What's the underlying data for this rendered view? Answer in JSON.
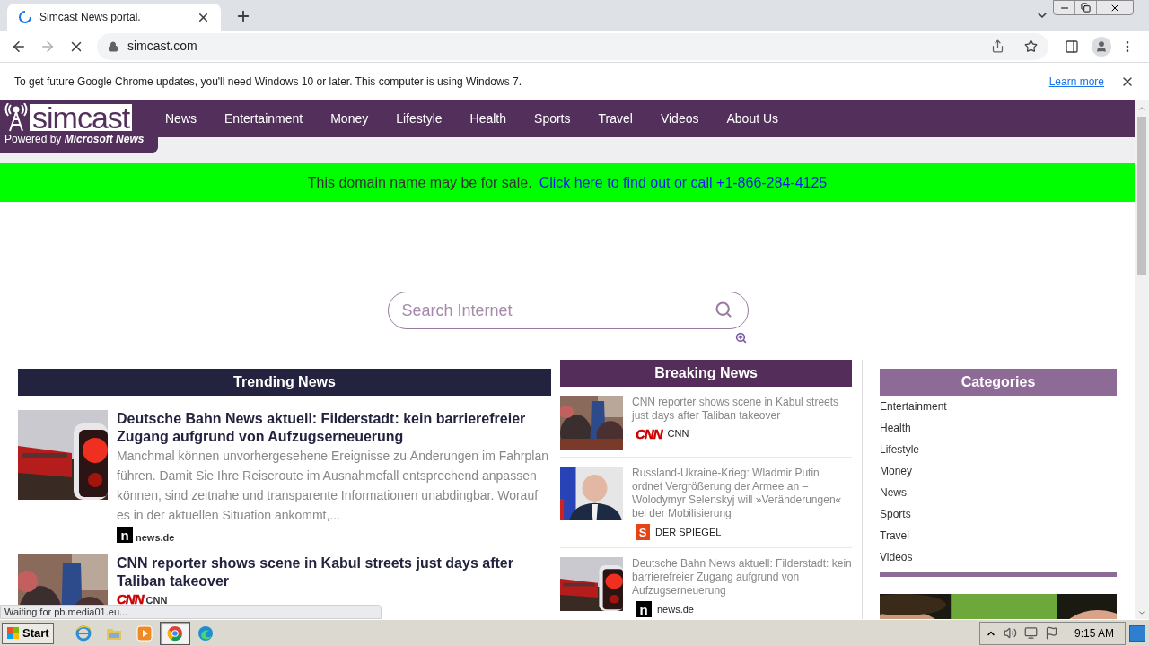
{
  "browser": {
    "tab": {
      "title": "Simcast News portal.",
      "loading": true
    },
    "address": "simcast.com",
    "infobar": {
      "message": "To get future Google Chrome updates, you'll need Windows 10 or later. This computer is using Windows 7.",
      "link": "Learn more"
    },
    "status": "Waiting for pb.media01.eu..."
  },
  "site": {
    "logo": {
      "name": "simcast",
      "tagline": "Powered by ",
      "tagline_bold": "Microsoft News"
    },
    "nav": [
      "News",
      "Entertainment",
      "Money",
      "Lifestyle",
      "Health",
      "Sports",
      "Travel",
      "Videos",
      "About Us"
    ],
    "banner": {
      "text": "This domain name may be for sale.",
      "link": "Click here to find out or call +1-866-284-4125"
    },
    "search": {
      "placeholder": "Search Internet"
    },
    "trending": {
      "title": "Trending News",
      "items": [
        {
          "title": "Deutsche Bahn News aktuell: Filderstadt: kein barrierefreier Zugang aufgrund von Aufzugserneuerung",
          "summary": "Manchmal können unvorhergesehene Ereignisse zu Änderungen im Fahrplan führen. Damit Sie Ihre Reiseroute im Ausnahmefall entsprechend anpassen können, sind zeitnahe und transparente Informationen unabdingbar. Worauf es in der aktuellen Situation ankommt,...",
          "logo": {
            "kind": "newsde",
            "text": "n"
          },
          "source": "news.de"
        },
        {
          "title": "CNN reporter shows scene in Kabul streets just days after Taliban takeover",
          "logo": {
            "kind": "cnn",
            "text": "CNN"
          },
          "source": "CNN"
        }
      ]
    },
    "breaking": {
      "title": "Breaking News",
      "items": [
        {
          "title": "CNN reporter shows scene in Kabul streets just days after Taliban takeover",
          "logo": {
            "kind": "cnn",
            "text": "CNN"
          },
          "source": "CNN"
        },
        {
          "title": "Russland-Ukraine-Krieg: Wladmir Putin ordnet Vergrößerung der Armee an – Wolodymyr Selenskyj will »Veränderungen« bei der Mobilisierung",
          "logo": {
            "kind": "spiegel",
            "text": "S"
          },
          "source": "DER SPIEGEL"
        },
        {
          "title": "Deutsche Bahn News aktuell: Filderstadt: kein barrierefreier Zugang aufgrund von Aufzugserneuerung",
          "logo": {
            "kind": "newsde",
            "text": "n"
          },
          "source": "news.de"
        }
      ]
    },
    "categories": {
      "title": "Categories",
      "items": [
        "Entertainment",
        "Health",
        "Lifestyle",
        "Money",
        "News",
        "Sports",
        "Travel",
        "Videos"
      ]
    }
  },
  "taskbar": {
    "start": "Start",
    "apps": [
      {
        "kind": "ie",
        "selected": false
      },
      {
        "kind": "folder",
        "selected": false
      },
      {
        "kind": "media",
        "selected": false
      },
      {
        "kind": "chrome",
        "selected": true
      },
      {
        "kind": "edge",
        "selected": false
      }
    ],
    "clock": "9:15 AM"
  }
}
